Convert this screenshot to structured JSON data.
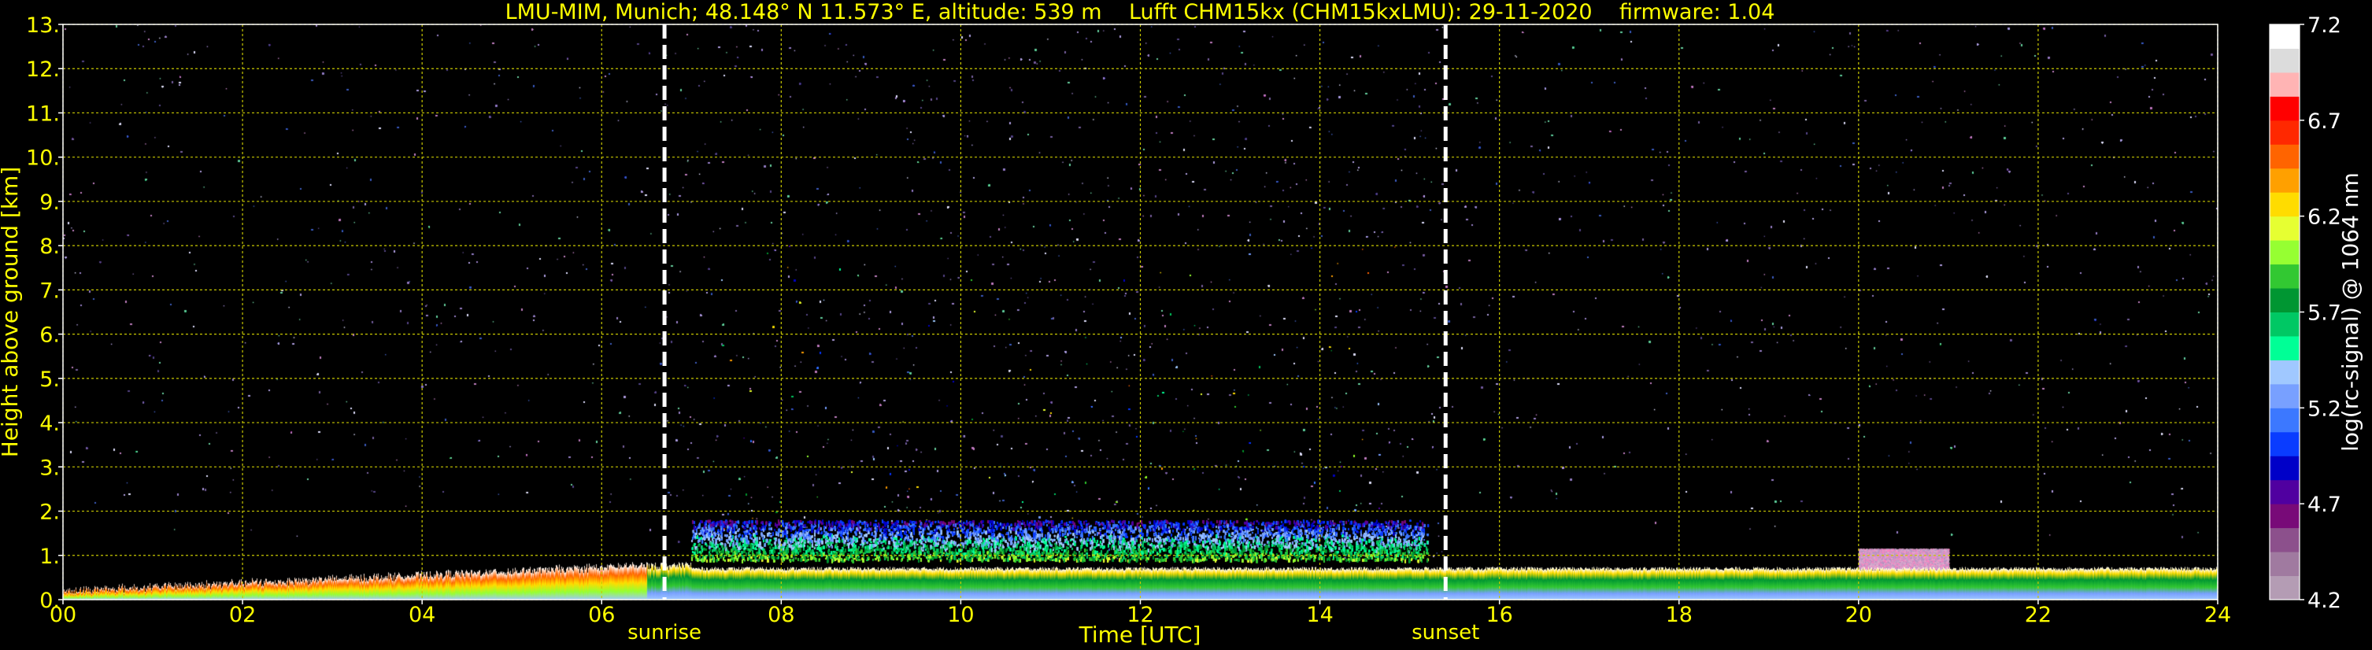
{
  "chart_data": {
    "type": "heatmap",
    "title": "LMU-MIM, Munich; 48.148° N 11.573° E, altitude: 539 m    Lufft CHM15kx (CHM15kxLMU): 29-11-2020    firmware: 1.04",
    "xlabel": "Time [UTC]",
    "ylabel": "Height above ground [km]",
    "xlim": [
      0,
      24
    ],
    "ylim": [
      0,
      13
    ],
    "x_ticks": [
      "00",
      "02",
      "04",
      "06",
      "08",
      "10",
      "12",
      "14",
      "16",
      "18",
      "20",
      "22",
      "24"
    ],
    "y_ticks": [
      "0.",
      "1.",
      "2.",
      "3.",
      "4.",
      "5.",
      "6.",
      "7.",
      "8.",
      "9.",
      "10.",
      "11.",
      "12.",
      "13."
    ],
    "grid": true,
    "markers": [
      {
        "label": "sunrise",
        "time": 6.7
      },
      {
        "label": "sunset",
        "time": 15.4
      }
    ],
    "colorbar": {
      "label": "log(rc-signal) @ 1064 nm",
      "min": 4.2,
      "max": 7.2,
      "ticks": [
        "4.2",
        "4.7",
        "5.2",
        "5.7",
        "6.2",
        "6.7",
        "7.2"
      ]
    },
    "features": [
      {
        "name": "boundary layer",
        "start": 0,
        "end": 24,
        "top_km": 0.7
      },
      {
        "name": "elevated aerosol layer",
        "start": 7.0,
        "end": 15.2,
        "bottom_km": 0.9,
        "top_km": 1.8
      },
      {
        "name": "low cloud",
        "start": 20.0,
        "end": 21.0,
        "bottom_km": 0.7,
        "top_km": 1.15
      }
    ]
  },
  "colors": {
    "background": "#000000",
    "grid": "#c8c800",
    "text": "#ffff00",
    "colorbar_text": "#ffffff",
    "marker": "#ffffff",
    "colormap": [
      "#b49cb4",
      "#a07aa0",
      "#8c508c",
      "#780a78",
      "#5000a0",
      "#0000c8",
      "#0a3cff",
      "#3c78ff",
      "#78a0ff",
      "#a0c8ff",
      "#00ff96",
      "#00c864",
      "#009632",
      "#32c832",
      "#96ff32",
      "#e6ff32",
      "#ffdc00",
      "#ffa000",
      "#ff6400",
      "#ff2800",
      "#ff0000",
      "#ffb4b4",
      "#dcdcdc",
      "#ffffff"
    ]
  }
}
